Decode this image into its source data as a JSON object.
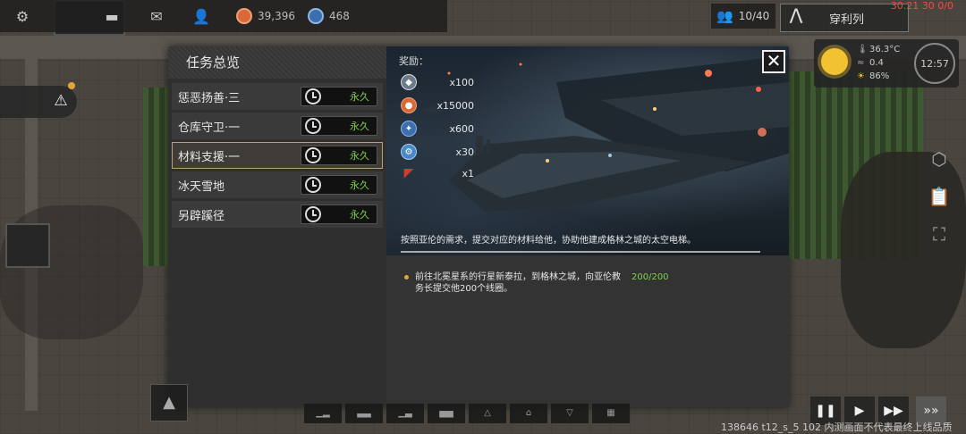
{
  "topbar": {
    "settings_icon": "gear-icon",
    "chat_icon": "chat-icon",
    "mail_icon": "mail-icon",
    "people_icon": "person-icon",
    "coins": "39,396",
    "crystals": "468",
    "population": "10/40",
    "faction_name": "穿利列",
    "clock_red": "30.21 30 0/0"
  },
  "weather": {
    "temperature": "36.3°C",
    "wind": "0.4",
    "sunlight": "86%",
    "time": "12:57"
  },
  "dialog": {
    "title": "任务总览",
    "quests": [
      {
        "name": "惩恶扬善·三",
        "duration": "永久"
      },
      {
        "name": "仓库守卫·一",
        "duration": "永久"
      },
      {
        "name": "材料支援·一",
        "duration": "永久"
      },
      {
        "name": "冰天雪地",
        "duration": "永久"
      },
      {
        "name": "另辟蹊径",
        "duration": "永久"
      }
    ],
    "reward_label": "奖励：",
    "rewards": [
      {
        "icon": "badge-icon",
        "qty": "x100",
        "color": "#6a7c8c"
      },
      {
        "icon": "coin-icon",
        "qty": "x15000",
        "color": "#d9693a"
      },
      {
        "icon": "gear-token-icon",
        "qty": "x600",
        "color": "#3d6fb0"
      },
      {
        "icon": "cog-token-icon",
        "qty": "x30",
        "color": "#4a88c8"
      },
      {
        "icon": "red-crystal-icon",
        "qty": "x1",
        "color": "#c0302a"
      }
    ],
    "description": "按照亚伦的需求，提交对应的材料给他，协助他建成格林之城的太空电梯。",
    "objective_text": "前往北冕星系的行星新泰拉，到格林之城，向亚伦教务长提交他200个线圈。",
    "objective_progress": "200/200"
  },
  "version": "138646 t12_s_5 102 内测画面不代表最终上线品质"
}
